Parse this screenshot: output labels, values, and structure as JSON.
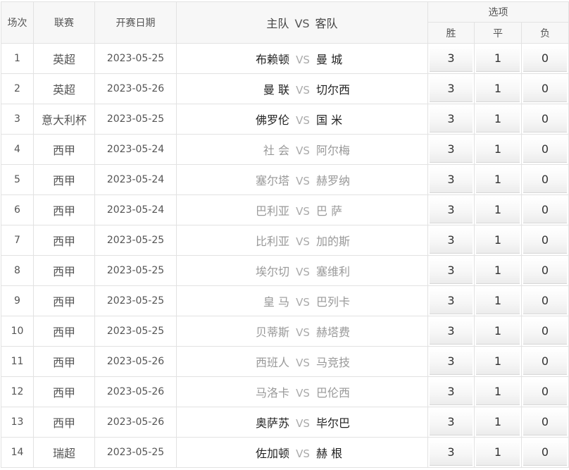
{
  "header": {
    "no": "场次",
    "league": "联赛",
    "date": "开赛日期",
    "home": "主队",
    "vs": "VS",
    "away": "客队",
    "options": "选项",
    "win": "胜",
    "draw": "平",
    "lose": "负"
  },
  "rows": [
    {
      "no": "1",
      "league": "英超",
      "date": "2023-05-25",
      "home": "布赖顿",
      "vs": "VS",
      "away": "曼 城",
      "win": "3",
      "draw": "1",
      "lose": "0"
    },
    {
      "no": "2",
      "league": "英超",
      "date": "2023-05-26",
      "home": "曼 联",
      "vs": "VS",
      "away": "切尔西",
      "win": "3",
      "draw": "1",
      "lose": "0"
    },
    {
      "no": "3",
      "league": "意大利杯",
      "date": "2023-05-25",
      "home": "佛罗伦",
      "vs": "VS",
      "away": "国 米",
      "win": "3",
      "draw": "1",
      "lose": "0"
    },
    {
      "no": "4",
      "league": "西甲",
      "date": "2023-05-24",
      "home": "社 会",
      "vs": "VS",
      "away": "阿尔梅",
      "win": "3",
      "draw": "1",
      "lose": "0"
    },
    {
      "no": "5",
      "league": "西甲",
      "date": "2023-05-24",
      "home": "塞尔塔",
      "vs": "VS",
      "away": "赫罗纳",
      "win": "3",
      "draw": "1",
      "lose": "0"
    },
    {
      "no": "6",
      "league": "西甲",
      "date": "2023-05-24",
      "home": "巴利亚",
      "vs": "VS",
      "away": "巴 萨",
      "win": "3",
      "draw": "1",
      "lose": "0"
    },
    {
      "no": "7",
      "league": "西甲",
      "date": "2023-05-25",
      "home": "比利亚",
      "vs": "VS",
      "away": "加的斯",
      "win": "3",
      "draw": "1",
      "lose": "0"
    },
    {
      "no": "8",
      "league": "西甲",
      "date": "2023-05-25",
      "home": "埃尔切",
      "vs": "VS",
      "away": "塞维利",
      "win": "3",
      "draw": "1",
      "lose": "0"
    },
    {
      "no": "9",
      "league": "西甲",
      "date": "2023-05-25",
      "home": "皇 马",
      "vs": "VS",
      "away": "巴列卡",
      "win": "3",
      "draw": "1",
      "lose": "0"
    },
    {
      "no": "10",
      "league": "西甲",
      "date": "2023-05-25",
      "home": "贝蒂斯",
      "vs": "VS",
      "away": "赫塔费",
      "win": "3",
      "draw": "1",
      "lose": "0"
    },
    {
      "no": "11",
      "league": "西甲",
      "date": "2023-05-26",
      "home": "西班人",
      "vs": "VS",
      "away": "马竞技",
      "win": "3",
      "draw": "1",
      "lose": "0"
    },
    {
      "no": "12",
      "league": "西甲",
      "date": "2023-05-26",
      "home": "马洛卡",
      "vs": "VS",
      "away": "巴伦西",
      "win": "3",
      "draw": "1",
      "lose": "0"
    },
    {
      "no": "13",
      "league": "西甲",
      "date": "2023-05-26",
      "home": "奥萨苏",
      "vs": "VS",
      "away": "毕尔巴",
      "win": "3",
      "draw": "1",
      "lose": "0"
    },
    {
      "no": "14",
      "league": "瑞超",
      "date": "2023-05-25",
      "home": "佐加顿",
      "vs": "VS",
      "away": "赫 根",
      "win": "3",
      "draw": "1",
      "lose": "0"
    }
  ],
  "colors": {
    "header_bg": "#f7f7f7",
    "border": "#e2e2e2",
    "team_dark": "#222222",
    "team_dim": "#999999",
    "vs": "#aaaaaa"
  }
}
